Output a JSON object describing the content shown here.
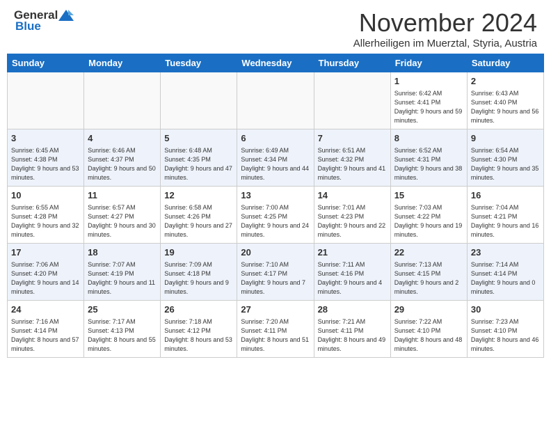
{
  "header": {
    "logo_general": "General",
    "logo_blue": "Blue",
    "month_title": "November 2024",
    "subtitle": "Allerheiligen im Muerztal, Styria, Austria"
  },
  "calendar": {
    "days_of_week": [
      "Sunday",
      "Monday",
      "Tuesday",
      "Wednesday",
      "Thursday",
      "Friday",
      "Saturday"
    ],
    "rows": [
      [
        {
          "day": "",
          "info": ""
        },
        {
          "day": "",
          "info": ""
        },
        {
          "day": "",
          "info": ""
        },
        {
          "day": "",
          "info": ""
        },
        {
          "day": "",
          "info": ""
        },
        {
          "day": "1",
          "info": "Sunrise: 6:42 AM\nSunset: 4:41 PM\nDaylight: 9 hours and 59 minutes."
        },
        {
          "day": "2",
          "info": "Sunrise: 6:43 AM\nSunset: 4:40 PM\nDaylight: 9 hours and 56 minutes."
        }
      ],
      [
        {
          "day": "3",
          "info": "Sunrise: 6:45 AM\nSunset: 4:38 PM\nDaylight: 9 hours and 53 minutes."
        },
        {
          "day": "4",
          "info": "Sunrise: 6:46 AM\nSunset: 4:37 PM\nDaylight: 9 hours and 50 minutes."
        },
        {
          "day": "5",
          "info": "Sunrise: 6:48 AM\nSunset: 4:35 PM\nDaylight: 9 hours and 47 minutes."
        },
        {
          "day": "6",
          "info": "Sunrise: 6:49 AM\nSunset: 4:34 PM\nDaylight: 9 hours and 44 minutes."
        },
        {
          "day": "7",
          "info": "Sunrise: 6:51 AM\nSunset: 4:32 PM\nDaylight: 9 hours and 41 minutes."
        },
        {
          "day": "8",
          "info": "Sunrise: 6:52 AM\nSunset: 4:31 PM\nDaylight: 9 hours and 38 minutes."
        },
        {
          "day": "9",
          "info": "Sunrise: 6:54 AM\nSunset: 4:30 PM\nDaylight: 9 hours and 35 minutes."
        }
      ],
      [
        {
          "day": "10",
          "info": "Sunrise: 6:55 AM\nSunset: 4:28 PM\nDaylight: 9 hours and 32 minutes."
        },
        {
          "day": "11",
          "info": "Sunrise: 6:57 AM\nSunset: 4:27 PM\nDaylight: 9 hours and 30 minutes."
        },
        {
          "day": "12",
          "info": "Sunrise: 6:58 AM\nSunset: 4:26 PM\nDaylight: 9 hours and 27 minutes."
        },
        {
          "day": "13",
          "info": "Sunrise: 7:00 AM\nSunset: 4:25 PM\nDaylight: 9 hours and 24 minutes."
        },
        {
          "day": "14",
          "info": "Sunrise: 7:01 AM\nSunset: 4:23 PM\nDaylight: 9 hours and 22 minutes."
        },
        {
          "day": "15",
          "info": "Sunrise: 7:03 AM\nSunset: 4:22 PM\nDaylight: 9 hours and 19 minutes."
        },
        {
          "day": "16",
          "info": "Sunrise: 7:04 AM\nSunset: 4:21 PM\nDaylight: 9 hours and 16 minutes."
        }
      ],
      [
        {
          "day": "17",
          "info": "Sunrise: 7:06 AM\nSunset: 4:20 PM\nDaylight: 9 hours and 14 minutes."
        },
        {
          "day": "18",
          "info": "Sunrise: 7:07 AM\nSunset: 4:19 PM\nDaylight: 9 hours and 11 minutes."
        },
        {
          "day": "19",
          "info": "Sunrise: 7:09 AM\nSunset: 4:18 PM\nDaylight: 9 hours and 9 minutes."
        },
        {
          "day": "20",
          "info": "Sunrise: 7:10 AM\nSunset: 4:17 PM\nDaylight: 9 hours and 7 minutes."
        },
        {
          "day": "21",
          "info": "Sunrise: 7:11 AM\nSunset: 4:16 PM\nDaylight: 9 hours and 4 minutes."
        },
        {
          "day": "22",
          "info": "Sunrise: 7:13 AM\nSunset: 4:15 PM\nDaylight: 9 hours and 2 minutes."
        },
        {
          "day": "23",
          "info": "Sunrise: 7:14 AM\nSunset: 4:14 PM\nDaylight: 9 hours and 0 minutes."
        }
      ],
      [
        {
          "day": "24",
          "info": "Sunrise: 7:16 AM\nSunset: 4:14 PM\nDaylight: 8 hours and 57 minutes."
        },
        {
          "day": "25",
          "info": "Sunrise: 7:17 AM\nSunset: 4:13 PM\nDaylight: 8 hours and 55 minutes."
        },
        {
          "day": "26",
          "info": "Sunrise: 7:18 AM\nSunset: 4:12 PM\nDaylight: 8 hours and 53 minutes."
        },
        {
          "day": "27",
          "info": "Sunrise: 7:20 AM\nSunset: 4:11 PM\nDaylight: 8 hours and 51 minutes."
        },
        {
          "day": "28",
          "info": "Sunrise: 7:21 AM\nSunset: 4:11 PM\nDaylight: 8 hours and 49 minutes."
        },
        {
          "day": "29",
          "info": "Sunrise: 7:22 AM\nSunset: 4:10 PM\nDaylight: 8 hours and 48 minutes."
        },
        {
          "day": "30",
          "info": "Sunrise: 7:23 AM\nSunset: 4:10 PM\nDaylight: 8 hours and 46 minutes."
        }
      ]
    ]
  }
}
